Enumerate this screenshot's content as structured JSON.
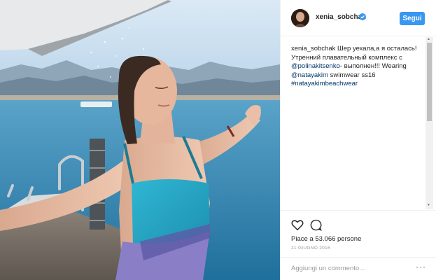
{
  "post": {
    "username": "xenia_sobchak",
    "follow_label": "Segui",
    "caption": {
      "username": "xenia_sobchak",
      "text1": " Шер уехала,а я осталась! Утренний плавательный комплекс с ",
      "mention1": "@polinakitsenko",
      "text2": "- выполнен!!! Wearing ",
      "mention2": "@natayakim",
      "text3": " swimwear ss16 ",
      "hashtag": "#natayakimbeachwear"
    },
    "likes": "Piace a 53.066 persone",
    "date": "21 GIUGNO 2016",
    "comment_placeholder": "Aggiungi un commento...",
    "more_label": "···"
  },
  "colors": {
    "accent": "#3897f0",
    "mention": "#003569",
    "sky": "#c9dff0",
    "sea": "#2f86b5",
    "swimsuit": "#26a9c9"
  },
  "icons": [
    "verified-badge-icon",
    "heart-icon",
    "comment-icon",
    "more-options-icon",
    "scroll-up-icon",
    "scroll-down-icon"
  ]
}
